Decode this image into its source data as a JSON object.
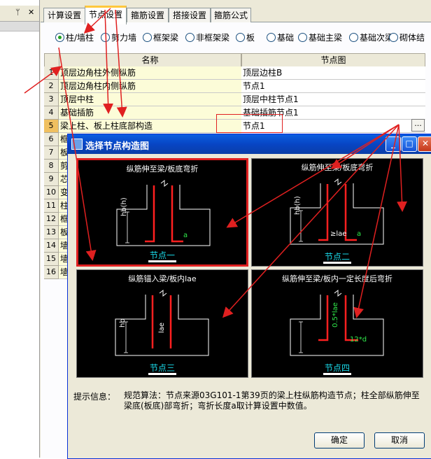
{
  "left_pane": {
    "pin_icon": "pin-icon",
    "close_icon": "close-icon"
  },
  "tabs": [
    {
      "label": "计算设置"
    },
    {
      "label": "节点设置"
    },
    {
      "label": "箍筋设置"
    },
    {
      "label": "搭接设置"
    },
    {
      "label": "箍筋公式"
    }
  ],
  "active_tab": 1,
  "radios": [
    {
      "label": "柱/墙柱",
      "checked": true
    },
    {
      "label": "剪力墙",
      "checked": false
    },
    {
      "label": "框架梁",
      "checked": false
    },
    {
      "label": "非框架梁",
      "checked": false
    },
    {
      "label": "板",
      "checked": false
    },
    {
      "label": "基础",
      "checked": false
    },
    {
      "label": "基础主梁",
      "checked": false
    },
    {
      "label": "基础次梁",
      "checked": false
    },
    {
      "label": "砌体结",
      "checked": false
    }
  ],
  "grid": {
    "col_name": "名称",
    "col_node": "节点图",
    "rows": [
      {
        "n": "1",
        "name": "顶层边角柱外侧纵筋",
        "node": "顶层边柱B"
      },
      {
        "n": "2",
        "name": "顶层边角柱内侧纵筋",
        "node": "节点1"
      },
      {
        "n": "3",
        "name": "顶层中柱",
        "node": "顶层中柱节点1"
      },
      {
        "n": "4",
        "name": "基础插筋",
        "node": "基础插筋节点1"
      },
      {
        "n": "5",
        "name": "梁上柱、板上柱底部构造",
        "node": "节点1"
      },
      {
        "n": "6",
        "name": "框",
        "node": ""
      },
      {
        "n": "7",
        "name": "板",
        "node": ""
      },
      {
        "n": "8",
        "name": "剪",
        "node": ""
      },
      {
        "n": "9",
        "name": "芯",
        "node": ""
      },
      {
        "n": "10",
        "name": "变",
        "node": ""
      },
      {
        "n": "11",
        "name": "柱",
        "node": ""
      },
      {
        "n": "12",
        "name": "框",
        "node": ""
      },
      {
        "n": "13",
        "name": "板",
        "node": ""
      },
      {
        "n": "14",
        "name": "墙",
        "node": ""
      },
      {
        "n": "15",
        "name": "墙",
        "node": ""
      },
      {
        "n": "16",
        "name": "墙",
        "node": ""
      }
    ],
    "ellipsis": "..."
  },
  "dialog": {
    "title": "选择节点构造图",
    "panels": [
      {
        "title": "纵筋伸至梁/板底弯折",
        "label": "节点一",
        "dim_v": "hb(h)",
        "dim_h": "a"
      },
      {
        "title": "纵筋伸至梁/板底弯折",
        "label": "节点二",
        "dim_v": "hb(h)",
        "dim_l": "≥lae",
        "dim_h": "a"
      },
      {
        "title": "纵筋锚入梁/板内lae",
        "label": "节点三",
        "dim_v": "hb",
        "dim_l": "lae"
      },
      {
        "title": "纵筋伸至梁/板内一定长度后弯折",
        "label": "节点四",
        "dim_l": "0.5*lae",
        "dim_h": "12*d"
      }
    ],
    "hint_label": "提示信息：",
    "hint_text": "规范算法：节点来源03G101-1第39页的梁上柱纵筋构造节点；柱全部纵筋伸至梁底(板底)部弯折；弯折长度a取计算设置中数值。",
    "ok": "确定",
    "cancel": "取消"
  },
  "colors": {
    "title_bar": "#0845c4",
    "highlight": "#e02020",
    "panel_bg": "#000000",
    "label": "#19d8e8",
    "arrow": "#e02020"
  }
}
